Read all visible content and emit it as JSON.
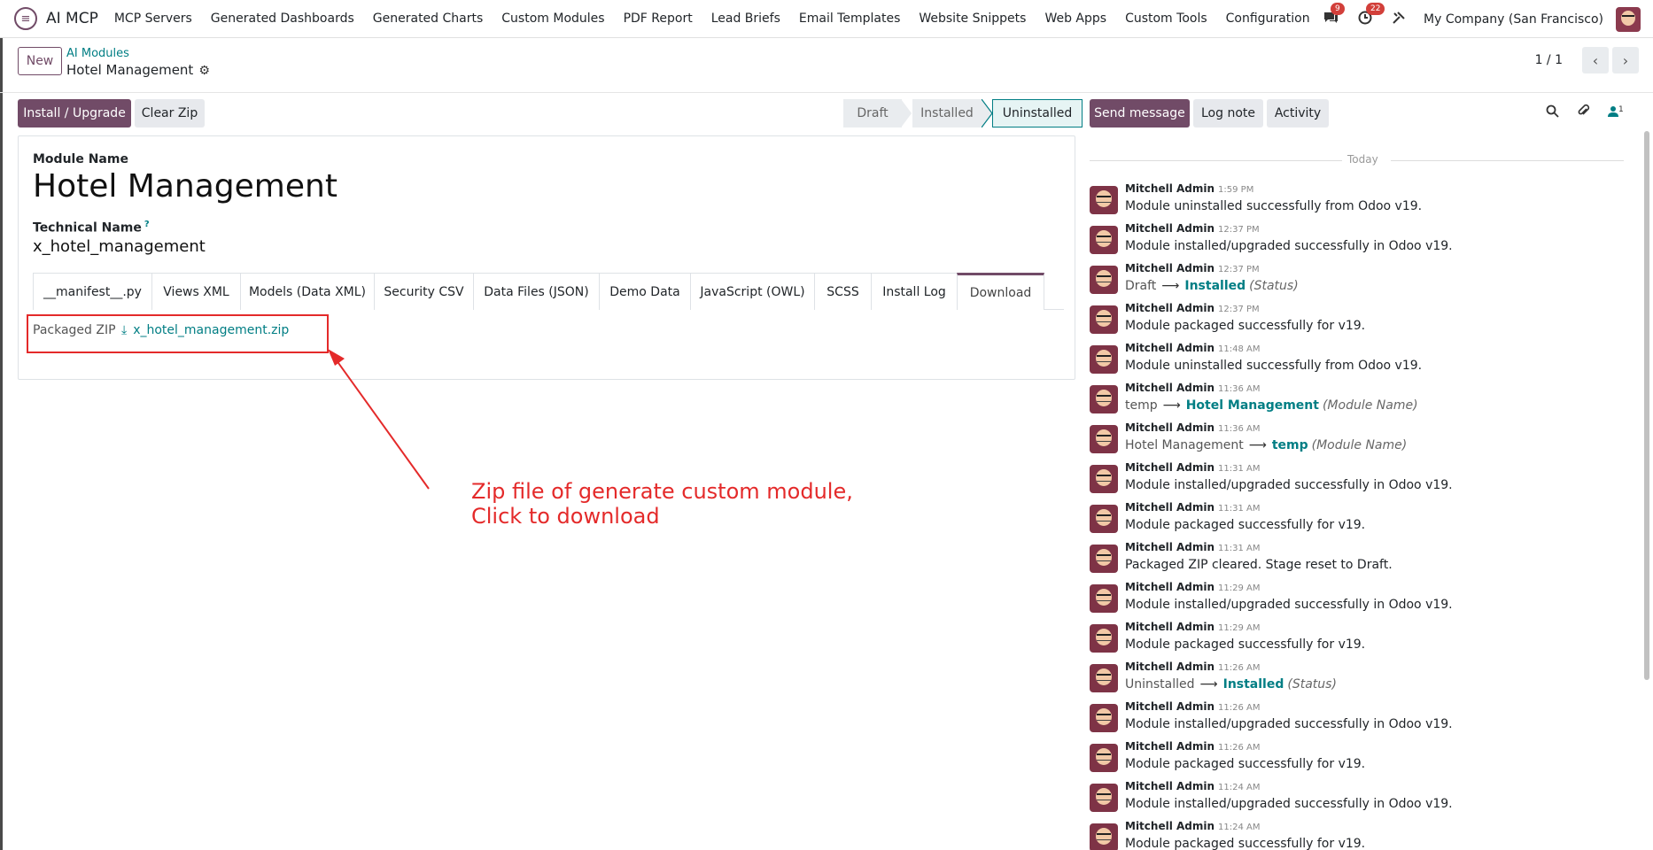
{
  "navbar": {
    "app_name": "AI MCP",
    "menu": [
      "MCP Servers",
      "Generated Dashboards",
      "Generated Charts",
      "Custom Modules",
      "PDF Report",
      "Lead Briefs",
      "Email Templates",
      "Website Snippets",
      "Web Apps",
      "Custom Tools",
      "Configuration"
    ],
    "messages_badge": "9",
    "activities_badge": "22",
    "company": "My Company (San Francisco)"
  },
  "control": {
    "new_label": "New",
    "breadcrumb_parent": "AI Modules",
    "breadcrumb_current": "Hotel Management",
    "pager": "1 / 1"
  },
  "actions": {
    "install_label": "Install / Upgrade",
    "clear_label": "Clear Zip"
  },
  "status": {
    "stages": [
      "Draft",
      "Installed",
      "Uninstalled"
    ],
    "active": "Uninstalled"
  },
  "form": {
    "module_name_label": "Module Name",
    "module_name": "Hotel Management",
    "tech_name_label": "Technical Name",
    "tech_name_help": "?",
    "tech_name": "x_hotel_management",
    "tabs": [
      "__manifest__.py",
      "Views XML",
      "Models (Data XML)",
      "Security CSV",
      "Data Files (JSON)",
      "Demo Data",
      "JavaScript (OWL)",
      "SCSS",
      "Install Log",
      "Download"
    ],
    "active_tab": "Download",
    "zip_label": "Packaged ZIP",
    "zip_file": "x_hotel_management.zip"
  },
  "annotation": {
    "line1": "Zip file of generate custom module,",
    "line2": "Click to download",
    "color": "#e42a2a"
  },
  "chatter": {
    "send_label": "Send message",
    "log_label": "Log note",
    "activity_label": "Activity",
    "followers_count": "1",
    "today_label": "Today",
    "messages": [
      {
        "author": "Mitchell Admin",
        "time": "1:59 PM",
        "text": "Module uninstalled successfully from Odoo v19."
      },
      {
        "author": "Mitchell Admin",
        "time": "12:37 PM",
        "text": "Module installed/upgraded successfully in Odoo v19."
      },
      {
        "author": "Mitchell Admin",
        "time": "12:37 PM",
        "change": {
          "from": "Draft",
          "to": "Installed",
          "field": "(Status)"
        }
      },
      {
        "author": "Mitchell Admin",
        "time": "12:37 PM",
        "text": "Module packaged successfully for v19."
      },
      {
        "author": "Mitchell Admin",
        "time": "11:48 AM",
        "text": "Module uninstalled successfully from Odoo v19."
      },
      {
        "author": "Mitchell Admin",
        "time": "11:36 AM",
        "change": {
          "from": "temp",
          "to": "Hotel Management",
          "field": "(Module Name)"
        }
      },
      {
        "author": "Mitchell Admin",
        "time": "11:36 AM",
        "change": {
          "from": "Hotel Management",
          "to": "temp",
          "field": "(Module Name)"
        }
      },
      {
        "author": "Mitchell Admin",
        "time": "11:31 AM",
        "text": "Module installed/upgraded successfully in Odoo v19."
      },
      {
        "author": "Mitchell Admin",
        "time": "11:31 AM",
        "text": "Module packaged successfully for v19."
      },
      {
        "author": "Mitchell Admin",
        "time": "11:31 AM",
        "text": "Packaged ZIP cleared. Stage reset to Draft."
      },
      {
        "author": "Mitchell Admin",
        "time": "11:29 AM",
        "text": "Module installed/upgraded successfully in Odoo v19."
      },
      {
        "author": "Mitchell Admin",
        "time": "11:29 AM",
        "text": "Module packaged successfully for v19."
      },
      {
        "author": "Mitchell Admin",
        "time": "11:26 AM",
        "change": {
          "from": "Uninstalled",
          "to": "Installed",
          "field": "(Status)"
        }
      },
      {
        "author": "Mitchell Admin",
        "time": "11:26 AM",
        "text": "Module installed/upgraded successfully in Odoo v19."
      },
      {
        "author": "Mitchell Admin",
        "time": "11:26 AM",
        "text": "Module packaged successfully for v19."
      },
      {
        "author": "Mitchell Admin",
        "time": "11:24 AM",
        "text": "Module installed/upgraded successfully in Odoo v19."
      },
      {
        "author": "Mitchell Admin",
        "time": "11:24 AM",
        "text": "Module packaged successfully for v19."
      }
    ]
  }
}
